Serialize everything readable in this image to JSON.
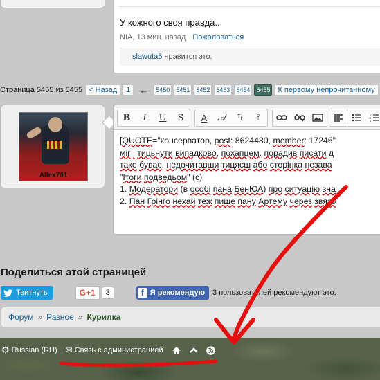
{
  "previous_post": {
    "text": "У кожного своя правда...",
    "author_time": "NIA, 13 мин. назад",
    "report_link": "Пожаловаться",
    "likes_user": "slawuta5",
    "likes_suffix": " нравится это."
  },
  "pagination": {
    "label": "Страница 5455 из 5455",
    "prev": "< Назад",
    "first": "1",
    "ellipsis": "←",
    "pages": [
      "5450",
      "5451",
      "5452",
      "5453",
      "5454",
      "5455"
    ],
    "current": "5455",
    "first_unread": "К первому непрочитанному"
  },
  "reply": {
    "avatar_name": "Allex761",
    "editor_lines": [
      [
        "[",
        {
          "u": "QUOTE"
        },
        "=\"консерватор, ",
        {
          "u": "post"
        },
        ": 8624480, ",
        {
          "u": "member"
        },
        ": 17246\""
      ],
      [
        {
          "u": "міг"
        },
        " ",
        {
          "u": "і"
        },
        " ",
        {
          "u": "тицьнути"
        },
        " ",
        {
          "u": "випадково"
        },
        ", ",
        {
          "u": "похапцем"
        },
        ". ",
        {
          "u": "порадив"
        },
        " ",
        {
          "u": "писати"
        },
        " ",
        {
          "u": "д"
        }
      ],
      [
        {
          "u": "таке"
        },
        " ",
        {
          "u": "буває"
        },
        ", ",
        {
          "u": "недочитавши"
        },
        " ",
        {
          "u": "тицяєш"
        },
        " ",
        {
          "u": "або"
        },
        " ",
        {
          "u": "сторінка"
        },
        " ",
        {
          "u": "незава"
        }
      ],
      [
        "\"",
        {
          "u": "Ітоги"
        },
        " ",
        {
          "u": "подведьом"
        },
        "\" (с)"
      ],
      [
        "1. ",
        {
          "u": "Модератори"
        },
        " (в ",
        {
          "u": "особі"
        },
        " ",
        {
          "u": "пана"
        },
        " ",
        {
          "u": "БенЮА"
        },
        ") ",
        {
          "u": "про"
        },
        " ",
        {
          "u": "ситуацію"
        },
        " ",
        {
          "u": "зна"
        }
      ],
      [
        "2. ",
        {
          "u": "Пан"
        },
        " ",
        {
          "u": "Грінго"
        },
        " ",
        {
          "u": "нехай"
        },
        " ",
        {
          "u": "теж"
        },
        " ",
        {
          "u": "пише"
        },
        " ",
        {
          "u": "пану"
        },
        " ",
        {
          "u": "Артему"
        },
        " ",
        {
          "u": "через"
        },
        " ",
        {
          "u": "звязо"
        }
      ]
    ]
  },
  "share": {
    "title": "Поделиться этой страницей",
    "twitter": "Твитнуть",
    "gplus": "G+1",
    "gplus_count": "3",
    "facebook": "Я рекомендую",
    "facebook_text": "3 пользователей рекомендуют это."
  },
  "breadcrumb": [
    "Форум",
    "Разное",
    "Курилка"
  ],
  "footer": {
    "language": "Russian (RU)",
    "contact": "Связь с администрацией"
  },
  "colors": {
    "link": "#176093",
    "current_page": "#3f6d60",
    "annotation": "#e41010",
    "footer_bg": "#56624a"
  }
}
